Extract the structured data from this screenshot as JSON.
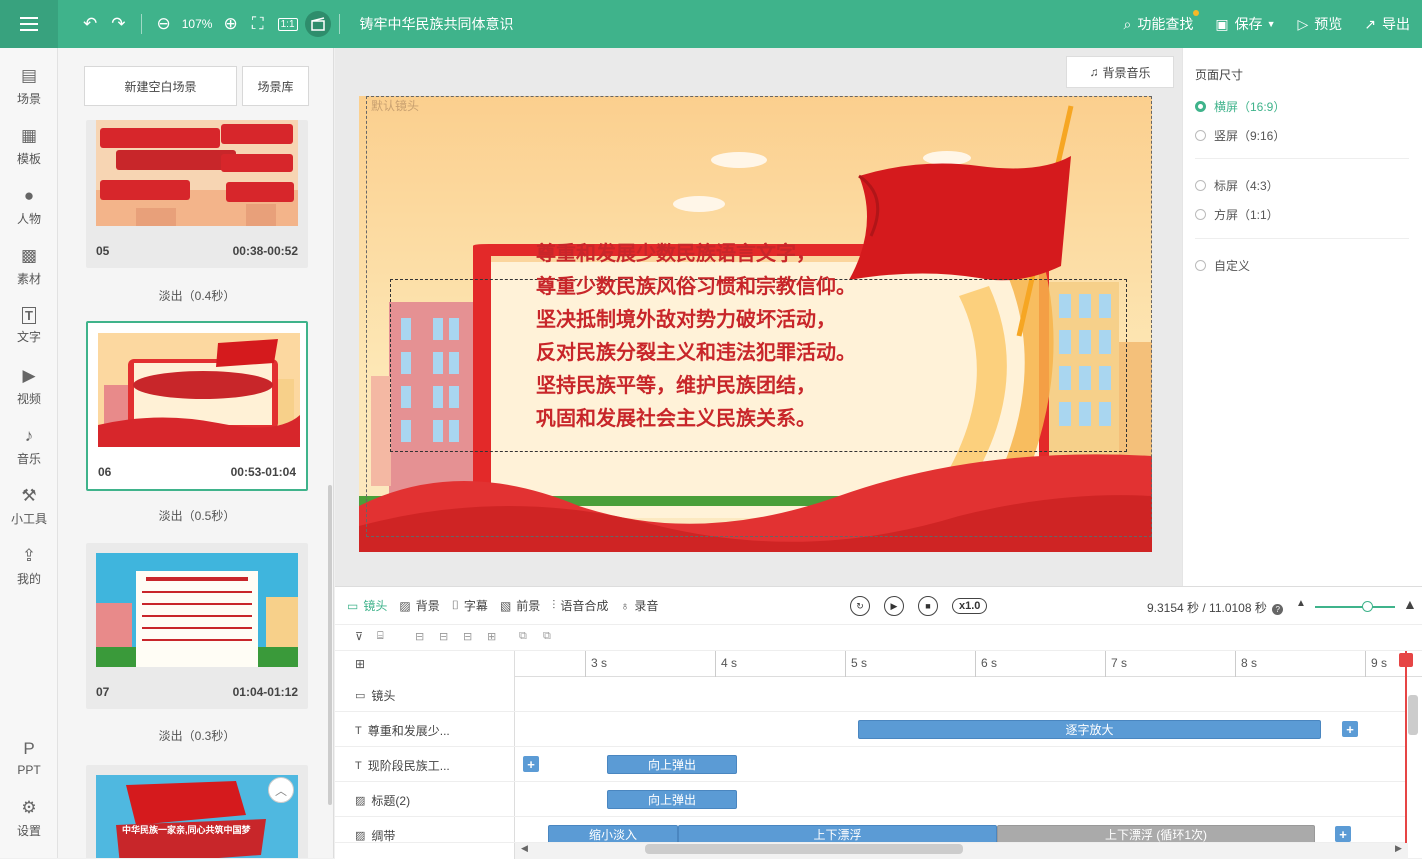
{
  "toolbar": {
    "zoom": "107%",
    "doc_title": "铸牢中华民族共同体意识",
    "actions": [
      {
        "label": "功能查找",
        "icon": "search-icon"
      },
      {
        "label": "保存",
        "icon": "save-icon"
      },
      {
        "label": "预览",
        "icon": "preview-icon"
      },
      {
        "label": "导出",
        "icon": "export-icon"
      }
    ]
  },
  "nav": [
    {
      "label": "场景",
      "icon": "scene-icon"
    },
    {
      "label": "模板",
      "icon": "template-icon"
    },
    {
      "label": "人物",
      "icon": "person-icon"
    },
    {
      "label": "素材",
      "icon": "material-icon"
    },
    {
      "label": "文字",
      "icon": "text-icon"
    },
    {
      "label": "视频",
      "icon": "video-icon"
    },
    {
      "label": "音乐",
      "icon": "music-icon"
    },
    {
      "label": "小工具",
      "icon": "tools-icon"
    },
    {
      "label": "我的",
      "icon": "upload-icon"
    }
  ],
  "nav_bottom": [
    {
      "label": "PPT",
      "icon": "ppt-icon"
    },
    {
      "label": "设置",
      "icon": "settings-icon"
    }
  ],
  "scene_panel": {
    "new_scene": "新建空白场景",
    "library": "场景库",
    "scenes": [
      {
        "num": "05",
        "time": "00:38-00:52",
        "transition": "淡出（0.4秒）"
      },
      {
        "num": "06",
        "time": "00:53-01:04",
        "transition": "淡出（0.5秒）"
      },
      {
        "num": "07",
        "time": "01:04-01:12",
        "transition": "淡出（0.3秒）"
      }
    ],
    "scene08_banner": "中华民族一家亲,同心共筑中国梦"
  },
  "canvas": {
    "bgm": "背景音乐",
    "default_lens": "默认镜头",
    "lines": [
      "尊重和发展少数民族语言文字，",
      "尊重少数民族风俗习惯和宗教信仰。",
      "坚决抵制境外敌对势力破坏活动，",
      "反对民族分裂主义和违法犯罪活动。",
      "坚持民族平等，维护民族团结，",
      "巩固和发展社会主义民族关系。"
    ]
  },
  "page_size": {
    "title": "页面尺寸",
    "options": [
      {
        "label": "横屏（16:9）",
        "selected": true
      },
      {
        "label": "竖屏（9:16）",
        "selected": false
      },
      {
        "label": "标屏（4:3）",
        "selected": false
      },
      {
        "label": "方屏（1:1）",
        "selected": false
      },
      {
        "label": "自定义",
        "selected": false
      }
    ]
  },
  "timeline": {
    "tabs": [
      "镜头",
      "背景",
      "字幕",
      "前景",
      "语音合成",
      "录音"
    ],
    "speed": "x1.0",
    "time": "9.3154 秒 / 11.0108 秒",
    "ticks": [
      "3 s",
      "4 s",
      "5 s",
      "6 s",
      "7 s",
      "8 s",
      "9 s"
    ],
    "tracks": [
      {
        "label": "镜头",
        "icon": "camera-icon"
      },
      {
        "label": "尊重和发展少...",
        "icon": "text-icon"
      },
      {
        "label": "现阶段民族工...",
        "icon": "text-icon"
      },
      {
        "label": "标题(2)",
        "icon": "image-icon"
      },
      {
        "label": "绸带",
        "icon": "image-icon"
      }
    ],
    "blocks": {
      "zoom_word": "逐字放大",
      "pop_up_1": "向上弹出",
      "pop_up_2": "向上弹出",
      "shrink_fade": "缩小淡入",
      "float": "上下漂浮",
      "float_loop": "上下漂浮 (循环1次)"
    }
  }
}
